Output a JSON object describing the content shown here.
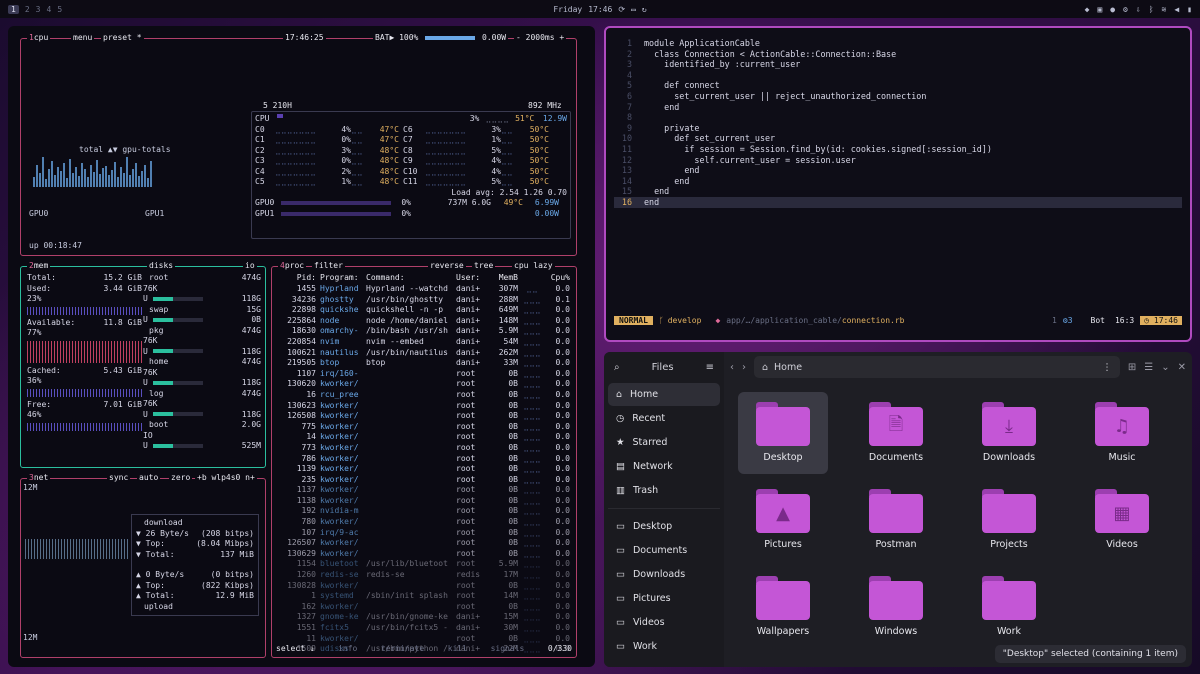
{
  "topbar": {
    "workspaces": [
      "1",
      "2",
      "3",
      "4",
      "5"
    ],
    "day": "Friday",
    "time": "17:46"
  },
  "btop": {
    "cpu": {
      "title_num": "1",
      "title": "cpu",
      "menu": "menu",
      "preset": "preset",
      "preset_value": "*",
      "clock": "17:46:25",
      "battery_label": "BAT▶",
      "battery_pct": "100%",
      "battery_rate": "0.00W",
      "interval": "- 2000ms +",
      "graph_total": "total ▲▼ gpu-totals",
      "gpu0_label": "GPU0",
      "gpu1_label": "GPU1",
      "uptime": "up 00:18:47",
      "model": "5 210H",
      "freq": "892 MHz",
      "total_row": {
        "label": "CPU",
        "pct": "3%",
        "temp": "51°C",
        "watt": "12.9W"
      },
      "cores": [
        {
          "a": "C0",
          "ap": "4%",
          "at": "47°C",
          "b": "C6",
          "bp": "3%",
          "bt": "50°C"
        },
        {
          "a": "C1",
          "ap": "0%",
          "at": "47°C",
          "b": "C7",
          "bp": "1%",
          "bt": "50°C"
        },
        {
          "a": "C2",
          "ap": "3%",
          "at": "48°C",
          "b": "C8",
          "bp": "5%",
          "bt": "50°C"
        },
        {
          "a": "C3",
          "ap": "0%",
          "at": "48°C",
          "b": "C9",
          "bp": "4%",
          "bt": "50°C"
        },
        {
          "a": "C4",
          "ap": "2%",
          "at": "48°C",
          "b": "C10",
          "bp": "4%",
          "bt": "50°C"
        },
        {
          "a": "C5",
          "ap": "1%",
          "at": "48°C",
          "b": "C11",
          "bp": "5%",
          "bt": "50°C"
        }
      ],
      "load_avg": "Load avg: 2.54 1.26 0.70",
      "gpu_rows": [
        {
          "label": "GPU0",
          "pct": "0%",
          "mem": "737M 6.0G",
          "temp": "49°C",
          "watt": "6.99W"
        },
        {
          "label": "GPU1",
          "pct": "0%",
          "mem": "",
          "temp": "",
          "watt": "0.00W"
        }
      ]
    },
    "mem": {
      "title_num": "2",
      "title": "mem",
      "disks_title": "disks",
      "io_title": "io",
      "rows": [
        {
          "label": "Total:",
          "value": "15.2 GiB"
        },
        {
          "label": "Used:",
          "value": "3.44 GiB"
        },
        {
          "label": "23%",
          "value": ""
        },
        {
          "label": "Available:",
          "value": "11.8 GiB"
        },
        {
          "label": "77%",
          "value": ""
        },
        {
          "label": "Cached:",
          "value": "5.43 GiB"
        },
        {
          "label": "36%",
          "value": ""
        },
        {
          "label": "Free:",
          "value": "7.01 GiB"
        },
        {
          "label": "46%",
          "value": ""
        }
      ],
      "disks": [
        {
          "name": "root",
          "size": "474G",
          "free": "76K",
          "u": "U",
          "used_label": "118G"
        },
        {
          "name": "swap",
          "size": "15G",
          "free": "",
          "u": "U",
          "used_label": "0B"
        },
        {
          "name": "pkg",
          "size": "474G",
          "free": "76K",
          "u": "U",
          "used_label": "118G"
        },
        {
          "name": "home",
          "size": "474G",
          "free": "76K",
          "u": "U",
          "used_label": "118G"
        },
        {
          "name": "log",
          "size": "474G",
          "free": "76K",
          "u": "U",
          "used_label": "118G"
        },
        {
          "name": "boot",
          "size": "2.0G",
          "free": "IO",
          "u": "U",
          "used_label": "525M"
        }
      ]
    },
    "net": {
      "title_num": "3",
      "title": "net",
      "sync": "sync",
      "auto": "auto",
      "zero": "zero",
      "iface": "+b wlp4s0 n+",
      "scale_top": "12M",
      "scale_bottom": "12M",
      "download_label": "download",
      "down_rows": [
        {
          "k": "▼ 26 Byte/s",
          "v": "(208 bitps)"
        },
        {
          "k": "▼ Top:",
          "v": "(8.04 Mibps)"
        },
        {
          "k": "▼ Total:",
          "v": "137 MiB"
        }
      ],
      "up_rows": [
        {
          "k": "▲ 0 Byte/s",
          "v": "(0 bitps)"
        },
        {
          "k": "▲ Top:",
          "v": "(822 Kibps)"
        },
        {
          "k": "▲ Total:",
          "v": "12.9 MiB"
        }
      ],
      "upload_label": "upload"
    },
    "proc": {
      "title_num": "4",
      "title": "proc",
      "filter": "filter",
      "reverse": "reverse",
      "tree": "tree",
      "sort": "cpu lazy",
      "headers": {
        "pid": "Pid:",
        "prog": "Program:",
        "cmd": "Command:",
        "user": "User:",
        "mem": "MemB",
        "cpu": "Cpu%"
      },
      "rows": [
        {
          "pid": "1455",
          "prog": "Hyprland",
          "cmd": "Hyprland --watchd",
          "user": "dani+",
          "mem": "307M",
          "spark": "⣀⣀",
          "cpu": "0.0"
        },
        {
          "pid": "34236",
          "prog": "ghostty",
          "cmd": "/usr/bin/ghostty",
          "user": "dani+",
          "mem": "288M",
          "spark": "⣀⣀⣀",
          "cpu": "0.1"
        },
        {
          "pid": "22898",
          "prog": "quickshe",
          "cmd": "quickshell -n -p",
          "user": "dani+",
          "mem": "649M",
          "spark": "⣀⣀⣀",
          "cpu": "0.0"
        },
        {
          "pid": "225864",
          "prog": "node",
          "cmd": "node /home/daniel",
          "user": "dani+",
          "mem": "148M",
          "spark": "⣀⣀⣀",
          "cpu": "0.0"
        },
        {
          "pid": "18630",
          "prog": "omarchy-",
          "cmd": "/bin/bash /usr/sh",
          "user": "dani+",
          "mem": "5.9M",
          "spark": "⣀⣀⣀",
          "cpu": "0.0"
        },
        {
          "pid": "220854",
          "prog": "nvim",
          "cmd": "nvim --embed",
          "user": "dani+",
          "mem": "54M",
          "spark": "⣀⣀⣀",
          "cpu": "0.0"
        },
        {
          "pid": "100621",
          "prog": "nautilus",
          "cmd": "/usr/bin/nautilus",
          "user": "dani+",
          "mem": "262M",
          "spark": "⣀⣀⣀",
          "cpu": "0.0"
        },
        {
          "pid": "219505",
          "prog": "btop",
          "cmd": "btop",
          "user": "dani+",
          "mem": "33M",
          "spark": "⣀⣀⣀",
          "cpu": "0.0"
        },
        {
          "pid": "1107",
          "prog": "irq/160-",
          "cmd": "",
          "user": "root",
          "mem": "0B",
          "spark": "⣀⣀⣀",
          "cpu": "0.0"
        },
        {
          "pid": "130620",
          "prog": "kworker/",
          "cmd": "",
          "user": "root",
          "mem": "0B",
          "spark": "⣀⣀⣀",
          "cpu": "0.0"
        },
        {
          "pid": "16",
          "prog": "rcu_pree",
          "cmd": "",
          "user": "root",
          "mem": "0B",
          "spark": "⣀⣀⣀",
          "cpu": "0.0"
        },
        {
          "pid": "130623",
          "prog": "kworker/",
          "cmd": "",
          "user": "root",
          "mem": "0B",
          "spark": "⣀⣀⣀",
          "cpu": "0.0"
        },
        {
          "pid": "126508",
          "prog": "kworker/",
          "cmd": "",
          "user": "root",
          "mem": "0B",
          "spark": "⣀⣀⣀",
          "cpu": "0.0"
        },
        {
          "pid": "775",
          "prog": "kworker/",
          "cmd": "",
          "user": "root",
          "mem": "0B",
          "spark": "⣀⣀⣀",
          "cpu": "0.0"
        },
        {
          "pid": "14",
          "prog": "kworker/",
          "cmd": "",
          "user": "root",
          "mem": "0B",
          "spark": "⣀⣀⣀",
          "cpu": "0.0"
        },
        {
          "pid": "773",
          "prog": "kworker/",
          "cmd": "",
          "user": "root",
          "mem": "0B",
          "spark": "⣀⣀⣀",
          "cpu": "0.0"
        },
        {
          "pid": "786",
          "prog": "kworker/",
          "cmd": "",
          "user": "root",
          "mem": "0B",
          "spark": "⣀⣀⣀",
          "cpu": "0.0"
        },
        {
          "pid": "1139",
          "prog": "kworker/",
          "cmd": "",
          "user": "root",
          "mem": "0B",
          "spark": "⣀⣀⣀",
          "cpu": "0.0"
        },
        {
          "pid": "235",
          "prog": "kworker/",
          "cmd": "",
          "user": "root",
          "mem": "0B",
          "spark": "⣀⣀⣀",
          "cpu": "0.0"
        },
        {
          "pid": "1137",
          "prog": "kworker/",
          "cmd": "",
          "user": "root",
          "mem": "0B",
          "spark": "⣀⣀⣀",
          "cpu": "0.0"
        },
        {
          "pid": "1138",
          "prog": "kworker/",
          "cmd": "",
          "user": "root",
          "mem": "0B",
          "spark": "⣀⣀⣀",
          "cpu": "0.0"
        },
        {
          "pid": "192",
          "prog": "nvidia-m",
          "cmd": "",
          "user": "root",
          "mem": "0B",
          "spark": "⣀⣀⣀",
          "cpu": "0.0"
        },
        {
          "pid": "780",
          "prog": "kworker/",
          "cmd": "",
          "user": "root",
          "mem": "0B",
          "spark": "⣀⣀⣀",
          "cpu": "0.0"
        },
        {
          "pid": "107",
          "prog": "irq/9-ac",
          "cmd": "",
          "user": "root",
          "mem": "0B",
          "spark": "⣀⣀⣀",
          "cpu": "0.0"
        },
        {
          "pid": "126507",
          "prog": "kworker/",
          "cmd": "",
          "user": "root",
          "mem": "0B",
          "spark": "⣀⣀⣀",
          "cpu": "0.0"
        },
        {
          "pid": "130629",
          "prog": "kworker/",
          "cmd": "",
          "user": "root",
          "mem": "0B",
          "spark": "⣀⣀⣀",
          "cpu": "0.0"
        },
        {
          "pid": "1154",
          "prog": "bluetoot",
          "cmd": "/usr/lib/bluetoot",
          "user": "root",
          "mem": "5.9M",
          "spark": "⣀⣀⣀",
          "cpu": "0.0"
        },
        {
          "pid": "1260",
          "prog": "redis-se",
          "cmd": "redis-se",
          "user": "redis",
          "mem": "17M",
          "spark": "⣀⣀⣀",
          "cpu": "0.0"
        },
        {
          "pid": "130828",
          "prog": "kworker/",
          "cmd": "",
          "user": "root",
          "mem": "0B",
          "spark": "⣀⣀⣀",
          "cpu": "0.0"
        },
        {
          "pid": "1",
          "prog": "systemd",
          "cmd": "/sbin/init splash",
          "user": "root",
          "mem": "14M",
          "spark": "⣀⣀⣀",
          "cpu": "0.0"
        },
        {
          "pid": "162",
          "prog": "kworker/",
          "cmd": "",
          "user": "root",
          "mem": "0B",
          "spark": "⣀⣀⣀",
          "cpu": "0.0"
        },
        {
          "pid": "1327",
          "prog": "gnome-ke",
          "cmd": "/usr/bin/gnome-ke",
          "user": "dani+",
          "mem": "15M",
          "spark": "⣀⣀⣀",
          "cpu": "0.0"
        },
        {
          "pid": "1551",
          "prog": "fcitx5",
          "cmd": "/usr/bin/fcitx5 -",
          "user": "dani+",
          "mem": "30M",
          "spark": "⣀⣀⣀",
          "cpu": "0.0"
        },
        {
          "pid": "11",
          "prog": "kworker/",
          "cmd": "",
          "user": "root",
          "mem": "0B",
          "spark": "⣀⣀⣀",
          "cpu": "0.0"
        },
        {
          "pid": "1509",
          "prog": "udisks",
          "cmd": "/usr/bin/python /",
          "user": "dani+",
          "mem": "22M",
          "spark": "⣀⣀⣀",
          "cpu": "0.0"
        }
      ],
      "footer_select": "select ↓",
      "footer_info": "info",
      "footer_terminate": "terminate",
      "footer_kill": "kill",
      "footer_signals": "signals",
      "footer_count": "0/330"
    }
  },
  "editor": {
    "lines": [
      {
        "n": "1",
        "t": "module ApplicationCable"
      },
      {
        "n": "2",
        "t": "  class Connection < ActionCable::Connection::Base"
      },
      {
        "n": "3",
        "t": "    identified_by :current_user"
      },
      {
        "n": "4",
        "t": ""
      },
      {
        "n": "5",
        "t": "    def connect"
      },
      {
        "n": "6",
        "t": "      set_current_user || reject_unauthorized_connection"
      },
      {
        "n": "7",
        "t": "    end"
      },
      {
        "n": "8",
        "t": ""
      },
      {
        "n": "9",
        "t": "    private"
      },
      {
        "n": "10",
        "t": "      def set_current_user"
      },
      {
        "n": "11",
        "t": "        if session = Session.find_by(id: cookies.signed[:session_id])"
      },
      {
        "n": "12",
        "t": "          self.current_user = session.user"
      },
      {
        "n": "13",
        "t": "        end"
      },
      {
        "n": "14",
        "t": "      end"
      },
      {
        "n": "15",
        "t": "  end"
      },
      {
        "n": "16",
        "t": "end"
      }
    ],
    "status": {
      "mode": "NORMAL",
      "branch": "develop",
      "path_prefix": "app/…/application_cable/",
      "filename": "connection.rb",
      "diag": "1",
      "lsp": "3",
      "pos_label": "Bot",
      "cursor": "16:3",
      "time": "17:46"
    }
  },
  "files": {
    "sidebar_title": "Files",
    "places": [
      "Home",
      "Recent",
      "Starred",
      "Network",
      "Trash"
    ],
    "bookmarks": [
      "Desktop",
      "Documents",
      "Downloads",
      "Pictures",
      "Videos",
      "Work"
    ],
    "path": "Home",
    "folders": [
      {
        "name": "Desktop",
        "glyph": ""
      },
      {
        "name": "Documents",
        "glyph": "🗎"
      },
      {
        "name": "Downloads",
        "glyph": "⤓"
      },
      {
        "name": "Music",
        "glyph": "♫"
      },
      {
        "name": "Pictures",
        "glyph": "▲"
      },
      {
        "name": "Postman",
        "glyph": ""
      },
      {
        "name": "Projects",
        "glyph": ""
      },
      {
        "name": "Videos",
        "glyph": "▦"
      },
      {
        "name": "Wallpapers",
        "glyph": ""
      },
      {
        "name": "Windows",
        "glyph": ""
      },
      {
        "name": "Work",
        "glyph": ""
      }
    ],
    "toast": "\"Desktop\" selected  (containing 1 item)"
  }
}
